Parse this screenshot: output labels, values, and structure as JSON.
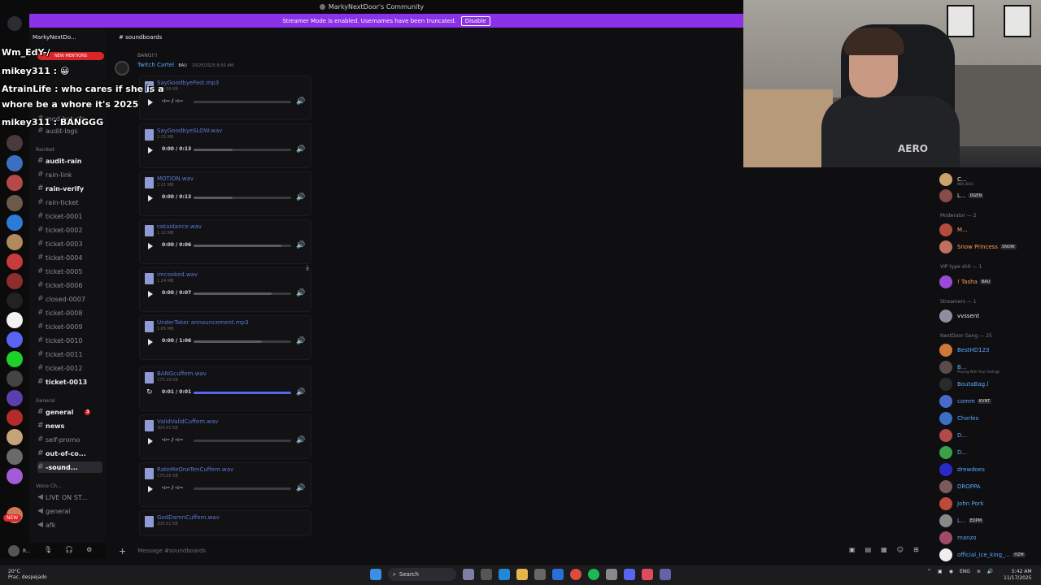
{
  "window": {
    "title": "MarkyNextDoor's Community"
  },
  "banner": {
    "text": "Streamer Mode is enabled. Usernames have been truncated.",
    "disable_label": "Disable"
  },
  "server": {
    "name": "MarkyNextDo...",
    "new_mentions": "NEW MENTIONS",
    "new_badge": "NEW"
  },
  "sidebar": {
    "top_channels": [
      {
        "label": "mod-bot-cfg"
      },
      {
        "label": "audit-logs"
      }
    ],
    "category_rainbet": "Rainbet",
    "rain_channels": [
      {
        "label": "audit-rain",
        "bright": true
      },
      {
        "label": "rain-link",
        "bright": false
      },
      {
        "label": "rain-verify",
        "bright": true
      },
      {
        "label": "rain-ticket",
        "bright": false
      },
      {
        "label": "ticket-0001",
        "bright": false
      },
      {
        "label": "ticket-0002",
        "bright": false
      },
      {
        "label": "ticket-0003",
        "bright": false
      },
      {
        "label": "ticket-0004",
        "bright": false
      },
      {
        "label": "ticket-0005",
        "bright": false
      },
      {
        "label": "ticket-0006",
        "bright": false
      },
      {
        "label": "closed-0007",
        "bright": false
      },
      {
        "label": "ticket-0008",
        "bright": false
      },
      {
        "label": "ticket-0009",
        "bright": false
      },
      {
        "label": "ticket-0010",
        "bright": false
      },
      {
        "label": "ticket-0011",
        "bright": false
      },
      {
        "label": "ticket-0012",
        "bright": false
      },
      {
        "label": "ticket-0013",
        "bright": true
      }
    ],
    "category_general": "General",
    "general_channels": [
      {
        "label": "general",
        "bright": true,
        "unread": "3"
      },
      {
        "label": "news",
        "bright": true
      },
      {
        "label": "self-promo",
        "bright": false
      },
      {
        "label": "out-of-co...",
        "bright": true
      },
      {
        "label": "-sound...",
        "bright": true,
        "selected": true
      }
    ],
    "category_voice": "Voice Ch...",
    "voice_channels": [
      {
        "label": "LIVE ON ST..."
      },
      {
        "label": "general"
      },
      {
        "label": "afk"
      }
    ]
  },
  "overlay_chat": [
    {
      "text": "Wm_EdY-/"
    },
    {
      "text": "mikey311 : 😀"
    },
    {
      "text": "AtrainLife : who cares if she is a"
    },
    {
      "text": "whore be a whore it's 2025"
    },
    {
      "text": "mikey311 : BANGGG"
    }
  ],
  "userbar": {
    "name": "R...",
    "status": ""
  },
  "channel_header": "soundboards",
  "message": {
    "reply": "BANG!!!",
    "author": "Twitch Cartel",
    "author_tag": "BAU",
    "timestamp": "10/25/2025 6:03 AM"
  },
  "attachments": [
    {
      "name": "SayGoodbyeFast.mp3",
      "size": "150.56 KB",
      "time": "-:-- / -:--",
      "progress": 0.0,
      "state": "play"
    },
    {
      "name": "SayGoodbyeSLOW.wav",
      "size": "2.25 MB",
      "time": "0:00 / 0:13",
      "progress": 0.4,
      "state": "play"
    },
    {
      "name": "MOTION.wav",
      "size": "2.21 MB",
      "time": "0:00 / 0:13",
      "progress": 0.4,
      "state": "play"
    },
    {
      "name": "rakaidance.wav",
      "size": "1.12 MB",
      "time": "0:00 / 0:06",
      "progress": 0.9,
      "state": "play"
    },
    {
      "name": "imcooked.wav",
      "size": "1.24 MB",
      "time": "0:00 / 0:07",
      "progress": 0.8,
      "state": "play"
    },
    {
      "name": "UnderTaker announcement.mp3",
      "size": "1.65 MB",
      "time": "0:00 / 1:06",
      "progress": 0.7,
      "state": "play"
    },
    {
      "name": "BANGcuffem.wav",
      "size": "175.29 KB",
      "time": "0:01 / 0:01",
      "progress": 1.0,
      "state": "replay"
    },
    {
      "name": "ValidValidCuffem.wav",
      "size": "304.01 KB",
      "time": "-:-- / -:--",
      "progress": 0.0,
      "state": "play"
    },
    {
      "name": "RateMeOneTenCuffem.wav",
      "size": "170.05 KB",
      "time": "-:-- / -:--",
      "progress": 0.0,
      "state": "play"
    },
    {
      "name": "GodDamnCuffem.wav",
      "size": "200.01 KB",
      "time": "",
      "progress": 0.0,
      "state": "play"
    }
  ],
  "composer": {
    "placeholder": "Message #soundboards"
  },
  "members": {
    "top": [
      {
        "name": "C...",
        "sub": "NBA 2K26",
        "color": "#e6e6e6"
      },
      {
        "name": "L...",
        "tag": "DGEN",
        "color": "#e6e6e6"
      }
    ],
    "moderator_header": "Moderator — 2",
    "moderators": [
      {
        "name": "M...",
        "color": "#ff9c5c"
      },
      {
        "name": "Snow Princess",
        "tag": "SNOW",
        "color": "#ff9c5c"
      }
    ],
    "vip_header": "VIP type shit — 1",
    "vip": [
      {
        "name": "! Tasha",
        "tag": "BAU",
        "color": "#ff9c5c"
      }
    ],
    "streamers_header": "Streamers — 1",
    "streamers": [
      {
        "name": "vvssent",
        "color": "#e6e6e6"
      }
    ],
    "gang_header": "NextDoor Gang — 25",
    "gang": [
      {
        "name": "BestHD123",
        "color": "#5aa8ff"
      },
      {
        "name": "B...",
        "sub": "Playing With Your Feelings",
        "color": "#5aa8ff"
      },
      {
        "name": "BoutaBag.l",
        "color": "#5aa8ff"
      },
      {
        "name": "comm",
        "tag": "KVNT",
        "color": "#5aa8ff"
      },
      {
        "name": "Chxrles",
        "color": "#5aa8ff"
      },
      {
        "name": "D...",
        "color": "#5aa8ff"
      },
      {
        "name": "D...",
        "color": "#5aa8ff"
      },
      {
        "name": "drewdoes",
        "color": "#5aa8ff"
      },
      {
        "name": "DROPPA",
        "color": "#5aa8ff"
      },
      {
        "name": "John Pork",
        "color": "#5aa8ff"
      },
      {
        "name": "L...",
        "tag": "EDPM",
        "color": "#5aa8ff"
      },
      {
        "name": "manzo",
        "color": "#5aa8ff"
      },
      {
        "name": "official_ice_king_...",
        "tag": "HZM",
        "color": "#5aa8ff"
      }
    ]
  },
  "taskbar": {
    "weather_temp": "20°C",
    "weather_desc": "Prac. despejado",
    "search_label": "Search",
    "lang": "ENG",
    "time": "5:42 AM",
    "date": "11/17/2025"
  }
}
